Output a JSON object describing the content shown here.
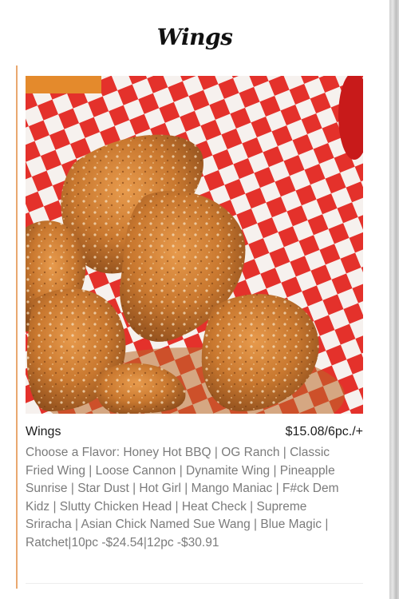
{
  "section": {
    "title": "Wings"
  },
  "item": {
    "name": "Wings",
    "price": "$15.08/6pc./+",
    "description": "Choose a Flavor: Honey Hot BBQ | OG Ranch | Classic Fried Wing | Loose Cannon | Dynamite Wing | Pineapple Sunrise | Star Dust | Hot Girl | Mango Maniac | F#ck Dem Kidz | Slutty Chicken Head | Heat Check | Supreme Sriracha | Asian Chick Named Sue Wang | Blue Magic | Ratchet|10pc -$24.54|12pc -$30.91"
  },
  "colors": {
    "accent": "#e9a86f",
    "checker_red": "#e4312b"
  }
}
